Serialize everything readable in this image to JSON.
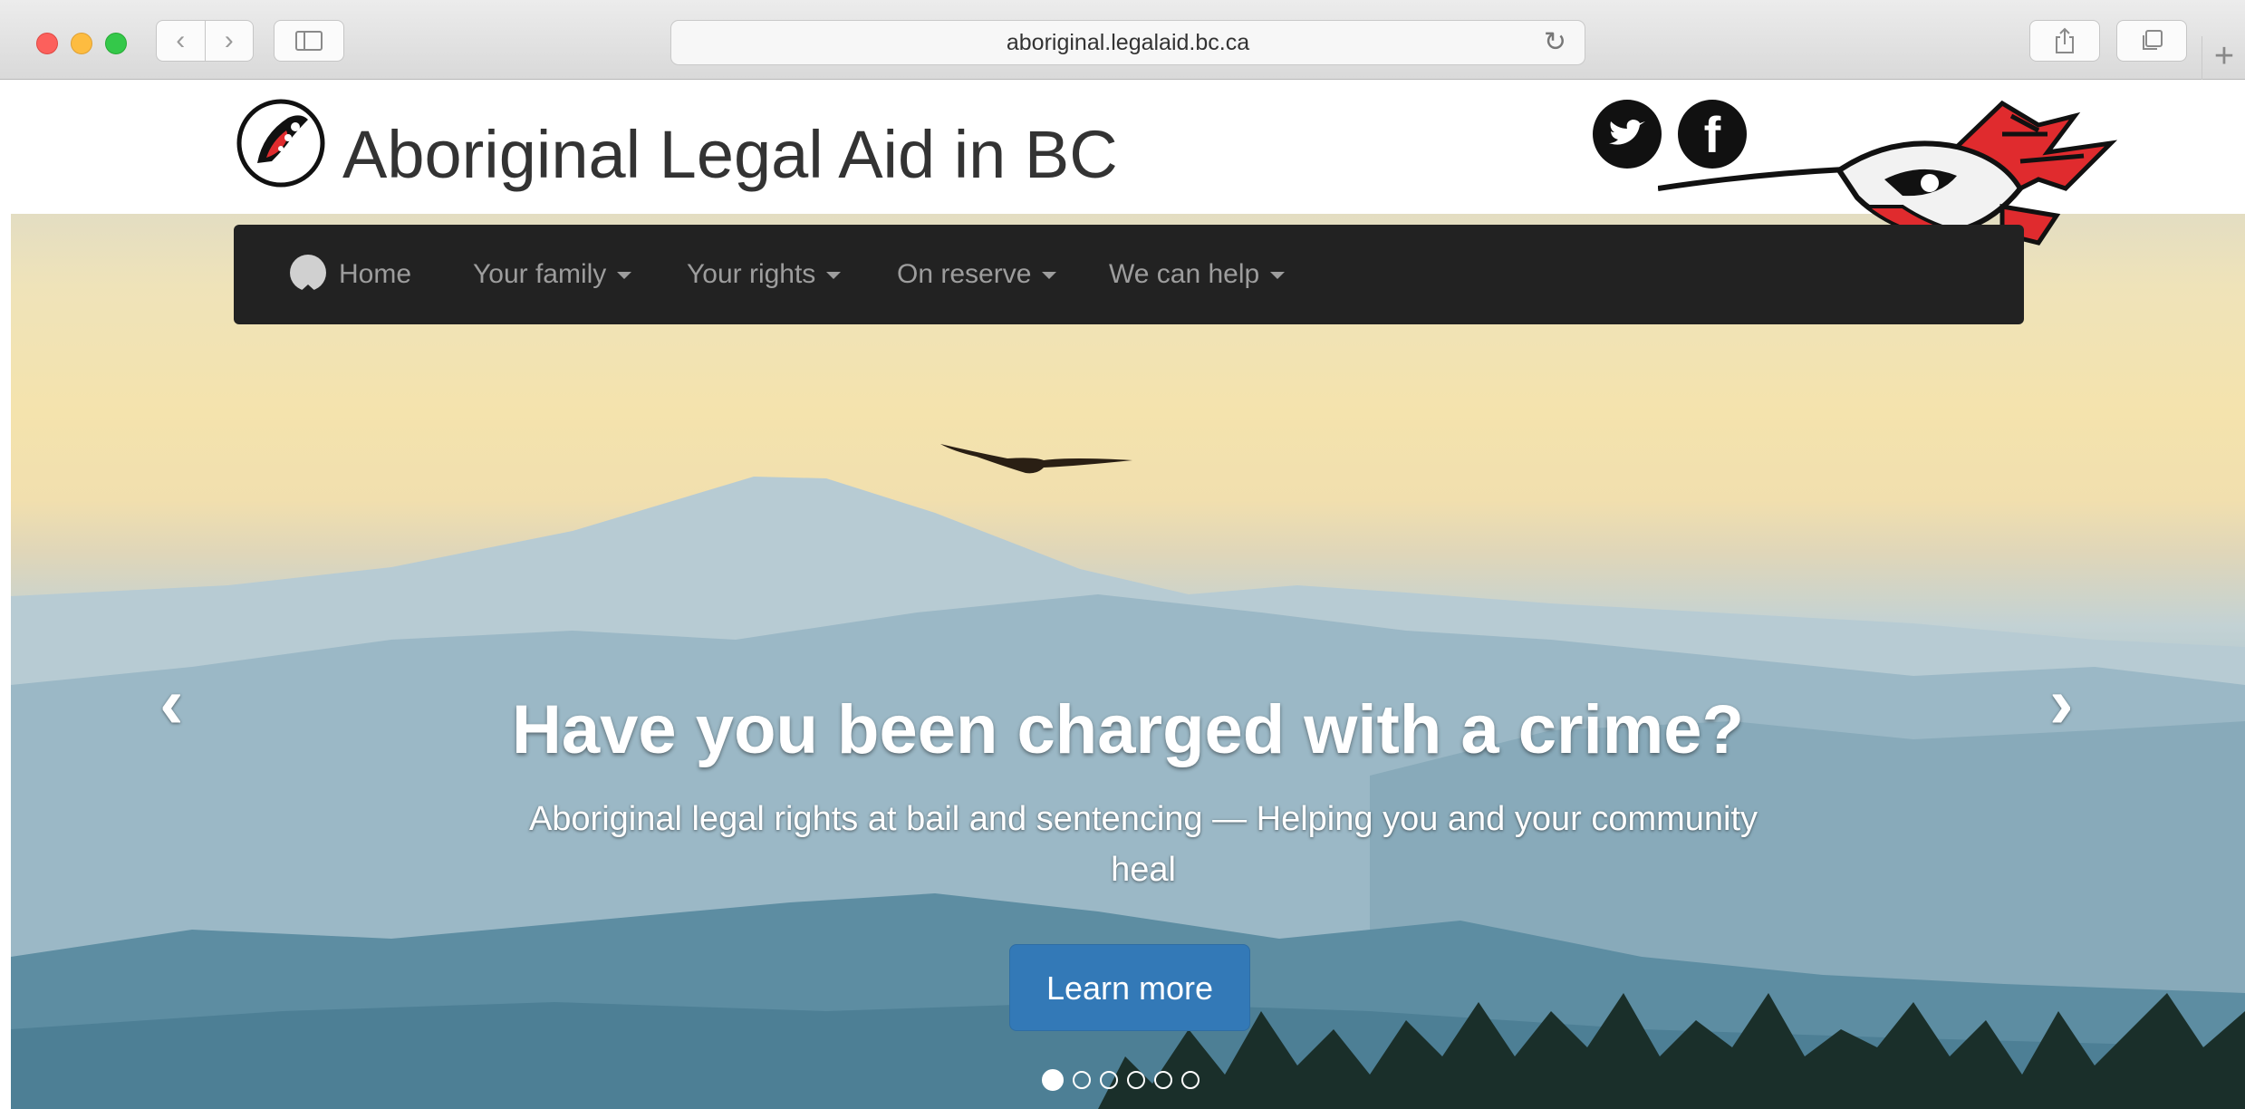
{
  "browser": {
    "url": "aboriginal.legalaid.bc.ca",
    "new_tab_label": "+"
  },
  "site": {
    "title": "Aboriginal Legal Aid in BC",
    "social": [
      {
        "name": "twitter",
        "icon": "twitter-icon"
      },
      {
        "name": "facebook",
        "icon": "facebook-icon",
        "glyph": "f"
      }
    ]
  },
  "nav": {
    "items": [
      {
        "label": "Home",
        "icon": "home-icon",
        "dropdown": false
      },
      {
        "label": "Your family",
        "dropdown": true
      },
      {
        "label": "Your rights",
        "dropdown": true
      },
      {
        "label": "On reserve",
        "dropdown": true
      },
      {
        "label": "We can help",
        "dropdown": true
      }
    ]
  },
  "hero": {
    "title": "Have you been charged with a crime?",
    "subtitle": "Aboriginal legal rights at bail and sentencing — Helping you and your community heal",
    "button_label": "Learn more",
    "slide_count": 6,
    "active_slide": 1,
    "prev_icon": "chevron-left-icon",
    "next_icon": "chevron-right-icon"
  },
  "colors": {
    "navbar_bg": "#222222",
    "button_primary": "#3379b7",
    "formline_red": "#e02b2e"
  }
}
